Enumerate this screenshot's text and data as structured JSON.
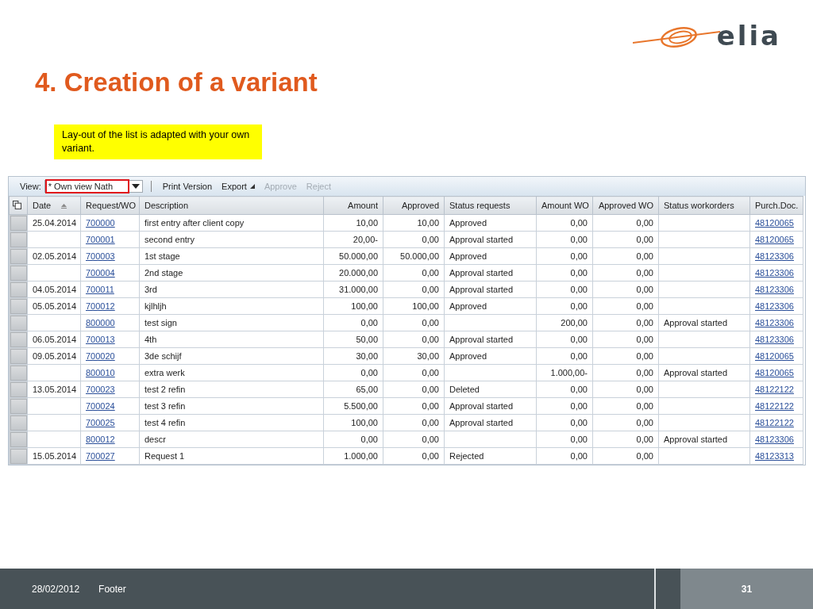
{
  "slide": {
    "title": "4. Creation of a variant",
    "logo": "elia",
    "callout": "Lay-out of the list is adapted with your own variant."
  },
  "toolbar": {
    "view_label": "View:",
    "view_value": "* Own view Nath",
    "view_highlighted": true,
    "buttons": [
      {
        "label": "Print Version",
        "disabled": false,
        "kind": "plain"
      },
      {
        "label": "Export",
        "disabled": false,
        "kind": "menu"
      },
      {
        "label": "Approve",
        "disabled": true,
        "kind": "plain"
      },
      {
        "label": "Reject",
        "disabled": true,
        "kind": "plain"
      }
    ]
  },
  "table": {
    "columns": [
      {
        "label": "Date",
        "sorted": true
      },
      {
        "label": "Request/WO",
        "sorted": false
      },
      {
        "label": "Description",
        "sorted": false
      },
      {
        "label": "Amount",
        "sorted": false
      },
      {
        "label": "Approved",
        "sorted": false
      },
      {
        "label": "Status requests",
        "sorted": false
      },
      {
        "label": "Amount WO",
        "sorted": false
      },
      {
        "label": "Approved WO",
        "sorted": false
      },
      {
        "label": "Status workorders",
        "sorted": false
      },
      {
        "label": "Purch.Doc.",
        "sorted": false
      }
    ],
    "rows": [
      [
        "25.04.2014",
        "700000",
        "first entry after client copy",
        "10,00",
        "10,00",
        "Approved",
        "0,00",
        "0,00",
        "",
        "48120065"
      ],
      [
        "",
        "700001",
        "second entry",
        "20,00-",
        "0,00",
        "Approval started",
        "0,00",
        "0,00",
        "",
        "48120065"
      ],
      [
        "02.05.2014",
        "700003",
        "1st stage",
        "50.000,00",
        "50.000,00",
        "Approved",
        "0,00",
        "0,00",
        "",
        "48123306"
      ],
      [
        "",
        "700004",
        "2nd stage",
        "20.000,00",
        "0,00",
        "Approval started",
        "0,00",
        "0,00",
        "",
        "48123306"
      ],
      [
        "04.05.2014",
        "700011",
        "3rd",
        "31.000,00",
        "0,00",
        "Approval started",
        "0,00",
        "0,00",
        "",
        "48123306"
      ],
      [
        "05.05.2014",
        "700012",
        "kjlhljh",
        "100,00",
        "100,00",
        "Approved",
        "0,00",
        "0,00",
        "",
        "48123306"
      ],
      [
        "",
        "800000",
        "test sign",
        "0,00",
        "0,00",
        "",
        "200,00",
        "0,00",
        "Approval started",
        "48123306"
      ],
      [
        "06.05.2014",
        "700013",
        "4th",
        "50,00",
        "0,00",
        "Approval started",
        "0,00",
        "0,00",
        "",
        "48123306"
      ],
      [
        "09.05.2014",
        "700020",
        "3de schijf",
        "30,00",
        "30,00",
        "Approved",
        "0,00",
        "0,00",
        "",
        "48120065"
      ],
      [
        "",
        "800010",
        "extra werk",
        "0,00",
        "0,00",
        "",
        "1.000,00-",
        "0,00",
        "Approval started",
        "48120065"
      ],
      [
        "13.05.2014",
        "700023",
        "test 2 refin",
        "65,00",
        "0,00",
        "Deleted",
        "0,00",
        "0,00",
        "",
        "48122122"
      ],
      [
        "",
        "700024",
        "test 3 refin",
        "5.500,00",
        "0,00",
        "Approval started",
        "0,00",
        "0,00",
        "",
        "48122122"
      ],
      [
        "",
        "700025",
        "test 4 refin",
        "100,00",
        "0,00",
        "Approval started",
        "0,00",
        "0,00",
        "",
        "48122122"
      ],
      [
        "",
        "800012",
        "descr",
        "0,00",
        "0,00",
        "",
        "0,00",
        "0,00",
        "Approval started",
        "48123306"
      ],
      [
        "15.05.2014",
        "700027",
        "Request 1",
        "1.000,00",
        "0,00",
        "Rejected",
        "0,00",
        "0,00",
        "",
        "48123313"
      ]
    ]
  },
  "footer": {
    "date": "28/02/2012",
    "text": "Footer",
    "page": "31"
  }
}
